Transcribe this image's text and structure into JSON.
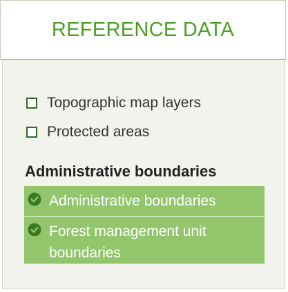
{
  "tab": {
    "title": "REFERENCE DATA"
  },
  "layers": [
    {
      "label": "Topographic map layers",
      "checked": false
    },
    {
      "label": "Protected areas",
      "checked": false
    }
  ],
  "section": {
    "heading": "Administrative boundaries",
    "items": [
      {
        "label": "Administrative boundaries",
        "selected": true,
        "icon": "check-circle-icon"
      },
      {
        "label": "Forest management unit boundaries",
        "selected": true,
        "icon": "check-circle-icon"
      }
    ]
  },
  "colors": {
    "accent_green": "#4aa121",
    "selected_bg": "#93c66c",
    "checkbox_border": "#2f6b2a",
    "check_icon": "#3b7a25"
  }
}
